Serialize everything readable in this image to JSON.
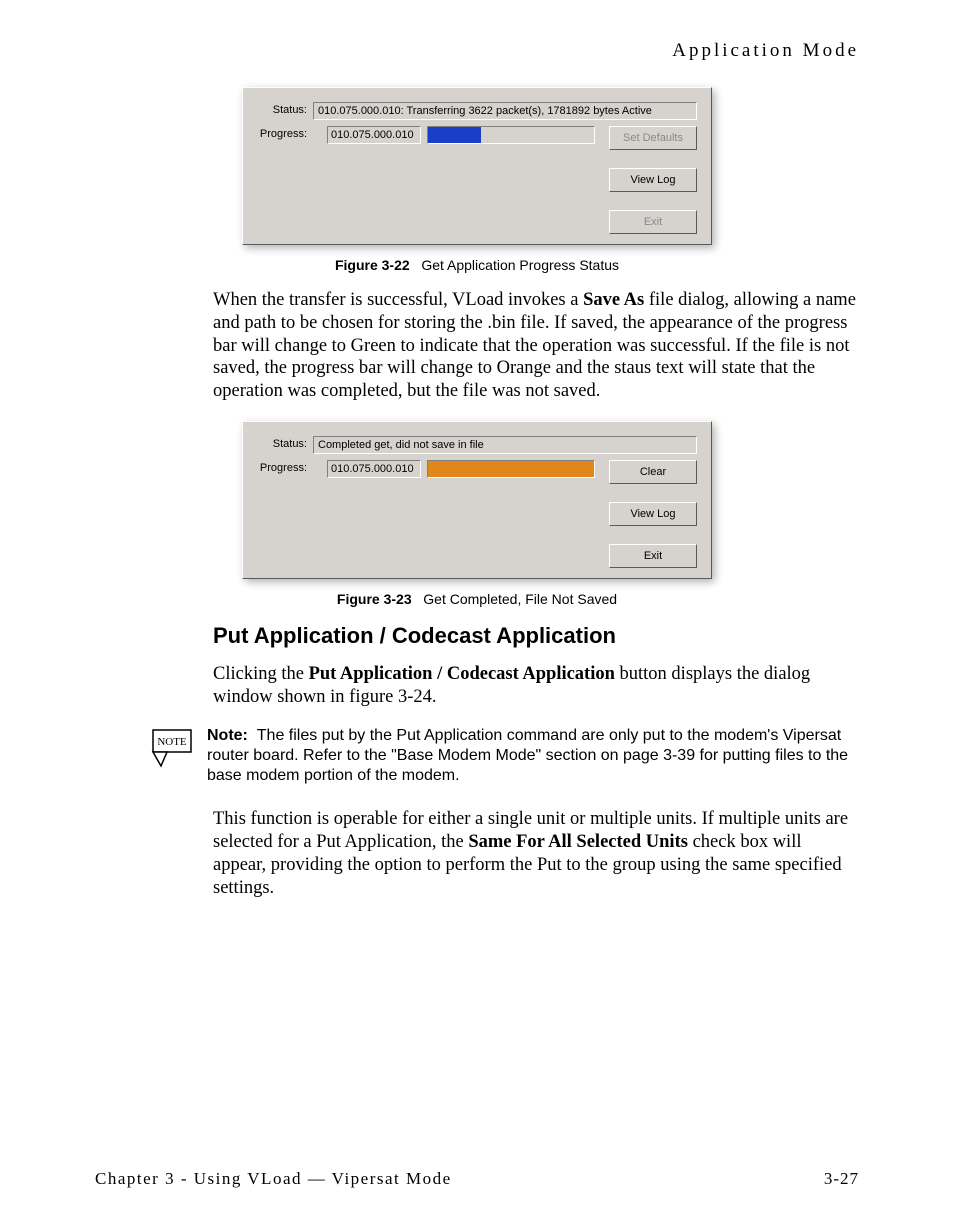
{
  "header": {
    "right": "Application Mode"
  },
  "figure1": {
    "status_label": "Status:",
    "status_value": "010.075.000.010: Transferring 3622 packet(s), 1781892 bytes Active",
    "progress_label": "Progress:",
    "progress_ip": "010.075.000.010",
    "bar_fill_pct": "32%",
    "btn1": "Set Defaults",
    "btn2": "View Log",
    "btn3": "Exit",
    "caption_num": "Figure 3-22",
    "caption_text": "Get Application Progress Status"
  },
  "para1_a": "When the transfer is successful, VLoad invokes a ",
  "para1_bold": "Save As",
  "para1_b": " file dialog, allowing a name and path to be chosen for storing the .bin file. If saved, the appearance of the progress bar will change to Green to indicate that the operation was successful. If the file is not saved, the progress bar will change to Orange and the staus text will state that the operation was completed, but the file was not saved.",
  "figure2": {
    "status_label": "Status:",
    "status_value": "Completed get, did not save in file",
    "progress_label": "Progress:",
    "progress_ip": "010.075.000.010",
    "bar_fill_pct": "100%",
    "btn1": "Clear",
    "btn2": "View Log",
    "btn3": "Exit",
    "caption_num": "Figure 3-23",
    "caption_text": "Get Completed, File Not Saved"
  },
  "section_heading": "Put Application / Codecast Application",
  "para2_a": "Clicking the ",
  "para2_bold": "Put Application / Codecast Application",
  "para2_b": " button displays the dialog window shown in figure 3-24.",
  "note": {
    "icon_label": "NOTE",
    "prefix": "Note:",
    "body": "The files put by the Put Application command are only put to the modem's Vipersat router board. Refer to the \"Base Modem Mode\" section on page 3-39 for putting files to the base modem portion of the modem."
  },
  "para3_a": "This function is operable for either a single unit or multiple units. If multiple units are selected for a Put Application, the ",
  "para3_bold": "Same For All Selected Units",
  "para3_b": " check box will appear, providing the option to perform the Put to the group using the same specified settings.",
  "footer": {
    "left": "Chapter 3 - Using VLoad — Vipersat Mode",
    "right": "3-27"
  }
}
